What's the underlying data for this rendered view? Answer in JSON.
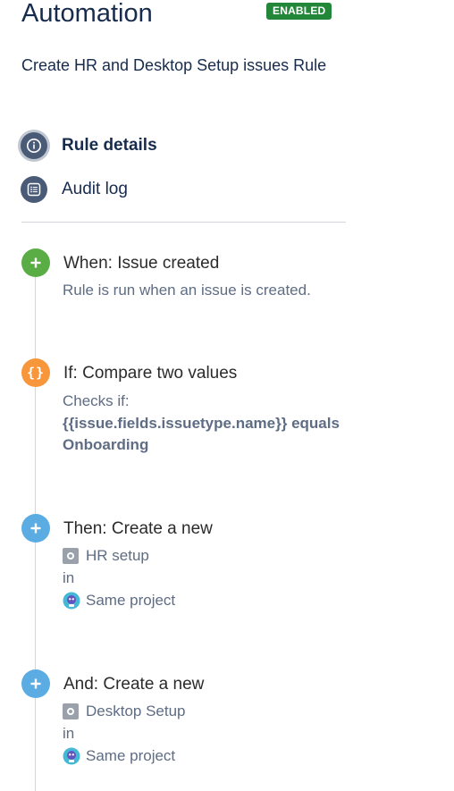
{
  "header": {
    "title": "Automation",
    "status_badge": "ENABLED",
    "rule_name": "Create HR and Desktop Setup issues Rule"
  },
  "nav": {
    "items": [
      {
        "label": "Rule details",
        "icon": "info-icon",
        "active": true
      },
      {
        "label": "Audit log",
        "icon": "list-icon",
        "active": false
      }
    ]
  },
  "steps": [
    {
      "title": "When: Issue created",
      "icon": "plus-icon",
      "color": "#5aac44",
      "description": "Rule is run when an issue is created."
    },
    {
      "title": "If: Compare two values",
      "icon": "braces-icon",
      "color": "#f7963b",
      "description": "Checks if:",
      "condition": "{{issue.fields.issuetype.name}} equals Onboarding"
    },
    {
      "title": "Then: Create a new",
      "icon": "plus-icon",
      "color": "#5aace3",
      "issue_type": "HR setup",
      "in_label": "in",
      "project": "Same project"
    },
    {
      "title": "And: Create a new",
      "icon": "plus-icon",
      "color": "#5aace3",
      "issue_type": "Desktop Setup",
      "in_label": "in",
      "project": "Same project"
    }
  ],
  "colors": {
    "badge": "#23873a",
    "nav_icon": "#4a5b78",
    "trigger": "#5aac44",
    "condition": "#f7963b",
    "action": "#5aace3"
  }
}
